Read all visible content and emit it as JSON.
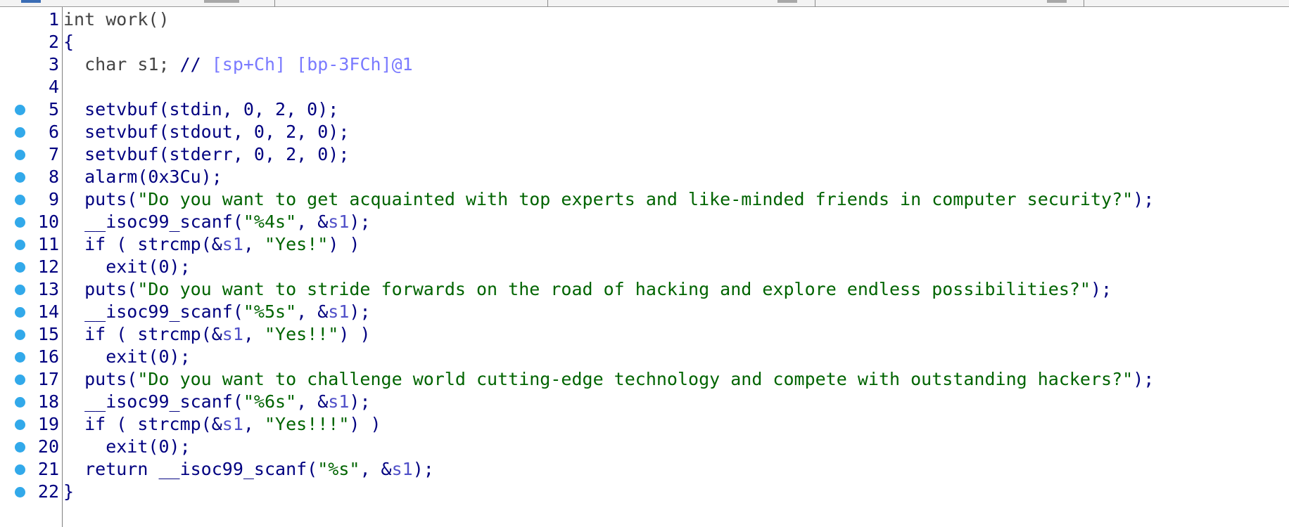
{
  "editor": {
    "lines": [
      {
        "num": "1",
        "bp": false,
        "tokens": [
          {
            "t": "plain",
            "v": "int work()"
          }
        ]
      },
      {
        "num": "2",
        "bp": false,
        "tokens": [
          {
            "t": "pun",
            "v": "{"
          }
        ]
      },
      {
        "num": "3",
        "bp": false,
        "tokens": [
          {
            "t": "plain",
            "v": "  char s1; "
          },
          {
            "t": "pun",
            "v": "// "
          },
          {
            "t": "cmt",
            "v": "[sp+Ch] [bp-3FCh]@1"
          }
        ]
      },
      {
        "num": "4",
        "bp": false,
        "tokens": []
      },
      {
        "num": "5",
        "bp": true,
        "tokens": [
          {
            "t": "kw",
            "v": "  setvbuf(stdin, 0, 2, 0);"
          }
        ]
      },
      {
        "num": "6",
        "bp": true,
        "tokens": [
          {
            "t": "kw",
            "v": "  setvbuf(stdout, 0, 2, 0);"
          }
        ]
      },
      {
        "num": "7",
        "bp": true,
        "tokens": [
          {
            "t": "kw",
            "v": "  setvbuf(stderr, 0, 2, 0);"
          }
        ]
      },
      {
        "num": "8",
        "bp": true,
        "tokens": [
          {
            "t": "kw",
            "v": "  alarm(0x3Cu);"
          }
        ]
      },
      {
        "num": "9",
        "bp": true,
        "tokens": [
          {
            "t": "kw",
            "v": "  puts("
          },
          {
            "t": "str",
            "v": "\"Do you want to get acquainted with top experts and like-minded friends in computer security?\""
          },
          {
            "t": "kw",
            "v": ");"
          }
        ]
      },
      {
        "num": "10",
        "bp": true,
        "tokens": [
          {
            "t": "kw",
            "v": "  __isoc99_scanf("
          },
          {
            "t": "str",
            "v": "\"%4s\""
          },
          {
            "t": "kw",
            "v": ", &"
          },
          {
            "t": "var",
            "v": "s1"
          },
          {
            "t": "kw",
            "v": ");"
          }
        ]
      },
      {
        "num": "11",
        "bp": true,
        "tokens": [
          {
            "t": "kw",
            "v": "  if ( strcmp(&"
          },
          {
            "t": "var",
            "v": "s1"
          },
          {
            "t": "kw",
            "v": ", "
          },
          {
            "t": "str",
            "v": "\"Yes!\""
          },
          {
            "t": "kw",
            "v": ") )"
          }
        ]
      },
      {
        "num": "12",
        "bp": true,
        "tokens": [
          {
            "t": "kw",
            "v": "    exit(0);"
          }
        ]
      },
      {
        "num": "13",
        "bp": true,
        "tokens": [
          {
            "t": "kw",
            "v": "  puts("
          },
          {
            "t": "str",
            "v": "\"Do you want to stride forwards on the road of hacking and explore endless possibilities?\""
          },
          {
            "t": "kw",
            "v": ");"
          }
        ]
      },
      {
        "num": "14",
        "bp": true,
        "tokens": [
          {
            "t": "kw",
            "v": "  __isoc99_scanf("
          },
          {
            "t": "str",
            "v": "\"%5s\""
          },
          {
            "t": "kw",
            "v": ", &"
          },
          {
            "t": "var",
            "v": "s1"
          },
          {
            "t": "kw",
            "v": ");"
          }
        ]
      },
      {
        "num": "15",
        "bp": true,
        "tokens": [
          {
            "t": "kw",
            "v": "  if ( strcmp(&"
          },
          {
            "t": "var",
            "v": "s1"
          },
          {
            "t": "kw",
            "v": ", "
          },
          {
            "t": "str",
            "v": "\"Yes!!\""
          },
          {
            "t": "kw",
            "v": ") )"
          }
        ]
      },
      {
        "num": "16",
        "bp": true,
        "tokens": [
          {
            "t": "kw",
            "v": "    exit(0);"
          }
        ]
      },
      {
        "num": "17",
        "bp": true,
        "tokens": [
          {
            "t": "kw",
            "v": "  puts("
          },
          {
            "t": "str",
            "v": "\"Do you want to challenge world cutting-edge technology and compete with outstanding hackers?\""
          },
          {
            "t": "kw",
            "v": ");"
          }
        ]
      },
      {
        "num": "18",
        "bp": true,
        "tokens": [
          {
            "t": "kw",
            "v": "  __isoc99_scanf("
          },
          {
            "t": "str",
            "v": "\"%6s\""
          },
          {
            "t": "kw",
            "v": ", &"
          },
          {
            "t": "var",
            "v": "s1"
          },
          {
            "t": "kw",
            "v": ");"
          }
        ]
      },
      {
        "num": "19",
        "bp": true,
        "tokens": [
          {
            "t": "kw",
            "v": "  if ( strcmp(&"
          },
          {
            "t": "var",
            "v": "s1"
          },
          {
            "t": "kw",
            "v": ", "
          },
          {
            "t": "str",
            "v": "\"Yes!!!\""
          },
          {
            "t": "kw",
            "v": ") )"
          }
        ]
      },
      {
        "num": "20",
        "bp": true,
        "tokens": [
          {
            "t": "kw",
            "v": "    exit(0);"
          }
        ]
      },
      {
        "num": "21",
        "bp": true,
        "tokens": [
          {
            "t": "kw",
            "v": "  return __isoc99_scanf("
          },
          {
            "t": "str",
            "v": "\"%s\""
          },
          {
            "t": "kw",
            "v": ", &"
          },
          {
            "t": "var",
            "v": "s1"
          },
          {
            "t": "kw",
            "v": ");"
          }
        ]
      },
      {
        "num": "22",
        "bp": true,
        "tokens": [
          {
            "t": "pun",
            "v": "}"
          }
        ]
      }
    ]
  },
  "colors": {
    "keyword": "#000080",
    "string": "#006400",
    "variable": "#5050c8",
    "comment": "#7a7aff",
    "breakpoint": "#32a9ea"
  }
}
